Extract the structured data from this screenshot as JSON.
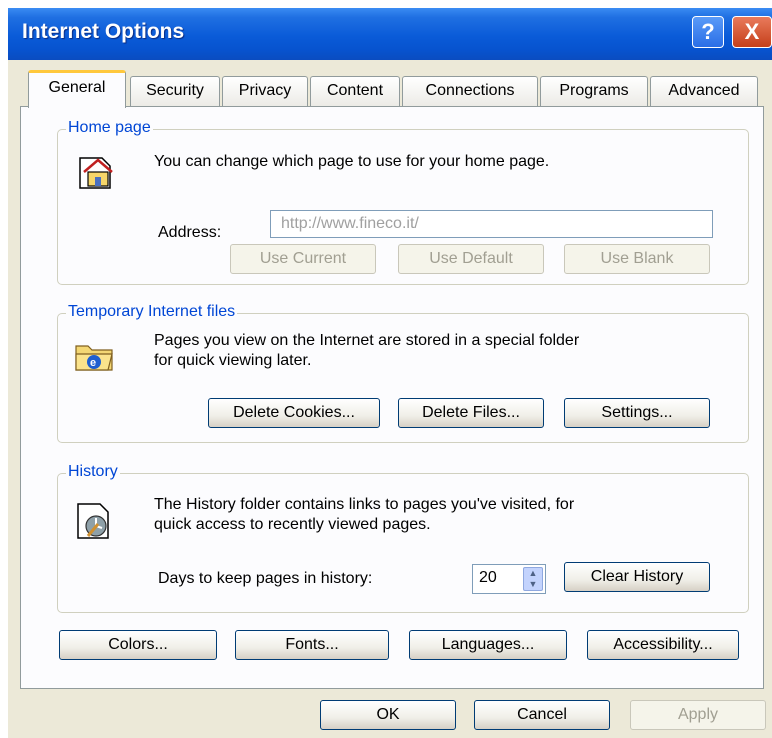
{
  "window": {
    "title": "Internet Options"
  },
  "titlebar_buttons": {
    "help": "?",
    "close": "X"
  },
  "tabs": [
    {
      "label": "General"
    },
    {
      "label": "Security"
    },
    {
      "label": "Privacy"
    },
    {
      "label": "Content"
    },
    {
      "label": "Connections"
    },
    {
      "label": "Programs"
    },
    {
      "label": "Advanced"
    }
  ],
  "home_page": {
    "legend": "Home page",
    "description": "You can change which page to use for your home page.",
    "address_label": "Address:",
    "address_value": "http://www.fineco.it/",
    "buttons": [
      "Use Current",
      "Use Default",
      "Use Blank"
    ]
  },
  "temp_files": {
    "legend": "Temporary Internet files",
    "description_line1": "Pages you view on the Internet are stored in a special folder",
    "description_line2": "for quick viewing later.",
    "buttons": [
      "Delete Cookies...",
      "Delete Files...",
      "Settings..."
    ]
  },
  "history": {
    "legend": "History",
    "description_line1": "The History folder contains links to pages you've visited, for",
    "description_line2": "quick access to recently viewed pages.",
    "days_label": "Days to keep pages in history:",
    "days_value": "20",
    "clear_button": "Clear History"
  },
  "bottom_buttons": [
    "Colors...",
    "Fonts...",
    "Languages...",
    "Accessibility..."
  ],
  "dialog_buttons": {
    "ok": "OK",
    "cancel": "Cancel",
    "apply": "Apply"
  }
}
